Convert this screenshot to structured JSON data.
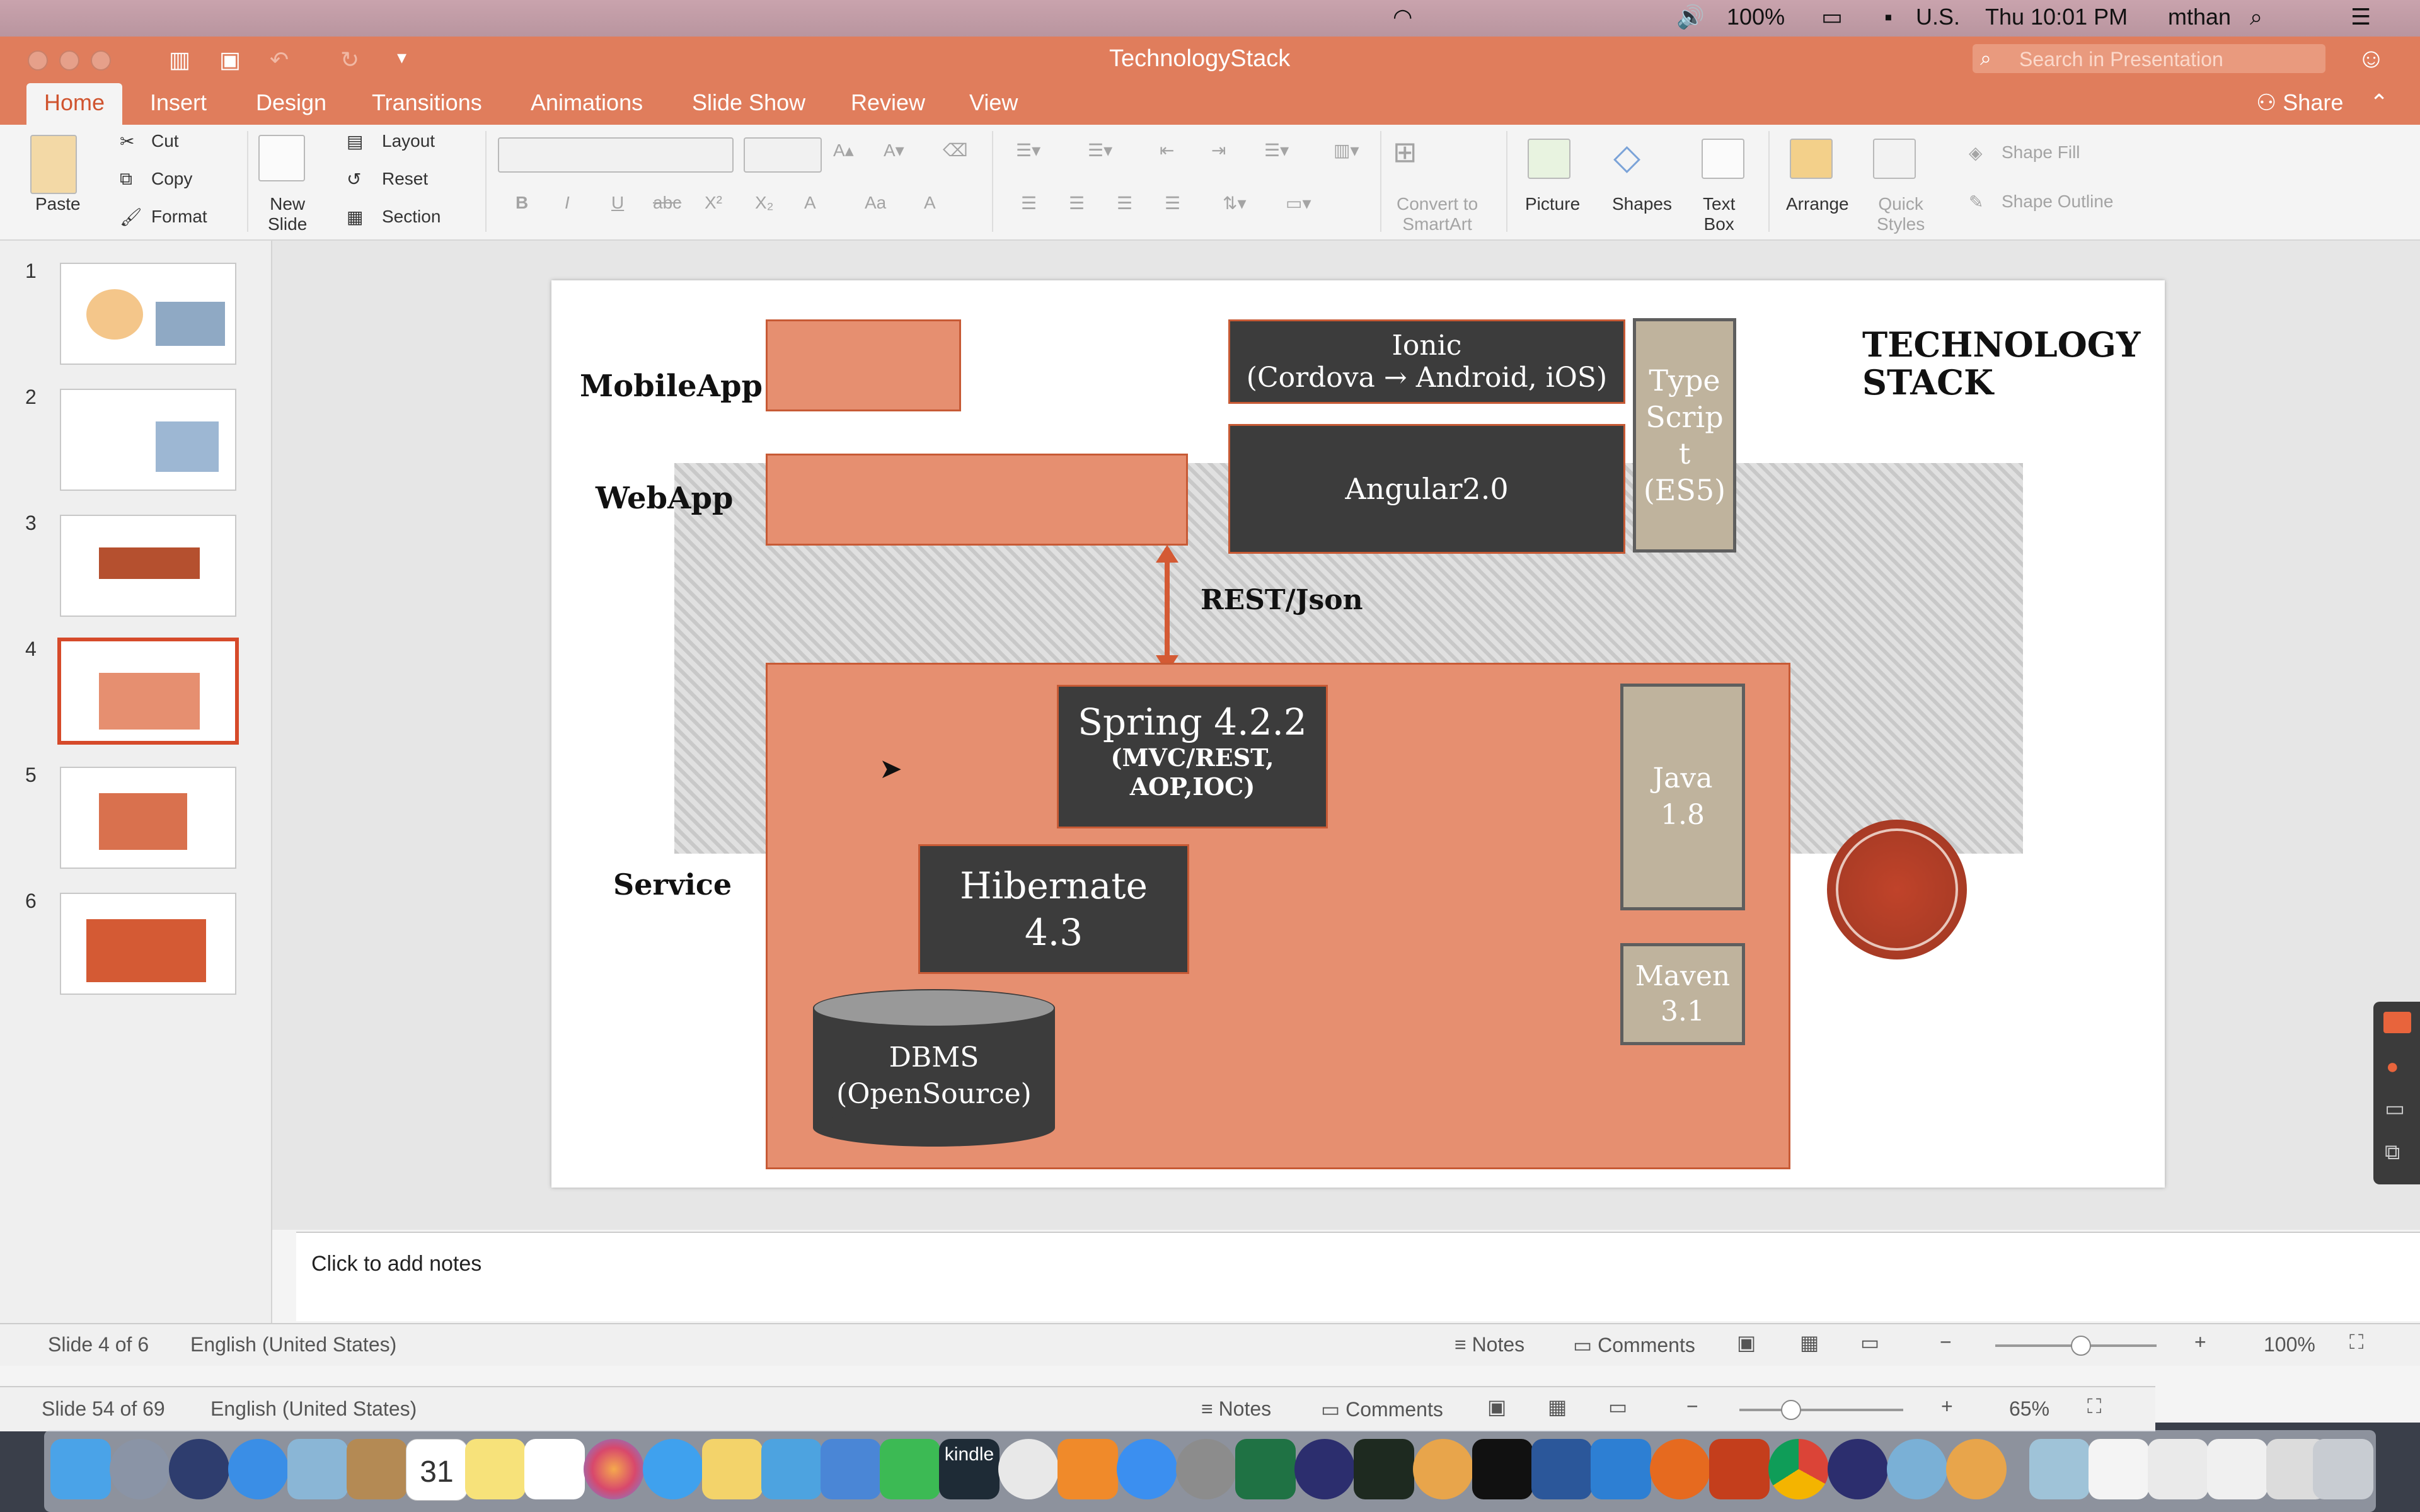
{
  "menubar": {
    "battery": "100%",
    "input_source": "U.S.",
    "clock": "Thu 10:01 PM",
    "user": "mthan"
  },
  "window": {
    "title": "TechnologyStack",
    "search_placeholder": "Search in Presentation",
    "share_label": "Share"
  },
  "tabs": [
    "Home",
    "Insert",
    "Design",
    "Transitions",
    "Animations",
    "Slide Show",
    "Review",
    "View"
  ],
  "ribbon": {
    "paste": "Paste",
    "cut": "Cut",
    "copy": "Copy",
    "format": "Format",
    "new_slide": "New\nSlide",
    "layout": "Layout",
    "reset": "Reset",
    "section": "Section",
    "convert": "Convert to\nSmartArt",
    "picture": "Picture",
    "shapes": "Shapes",
    "textbox": "Text\nBox",
    "arrange": "Arrange",
    "quick_styles": "Quick\nStyles",
    "shape_fill": "Shape Fill",
    "shape_outline": "Shape Outline"
  },
  "thumbnails": [
    "1",
    "2",
    "3",
    "4",
    "5",
    "6"
  ],
  "slide": {
    "title": "TECHNOLOGY\nSTACK",
    "label_mobile": "MobileApp",
    "label_web": "WebApp",
    "label_service": "Service",
    "ionic": "Ionic\n(Cordova → Android, iOS)",
    "angular": "Angular2.0",
    "typescript": "Type\nScrip\nt\n(ES5)",
    "rest": "REST/Json",
    "spring": "Spring 4.2.2",
    "spring_sub": "(MVC/REST,\nAOP,IOC)",
    "hibernate": "Hibernate\n4.3",
    "java": "Java\n1.8",
    "maven": "Maven\n3.1",
    "dbms": "DBMS\n(OpenSource)"
  },
  "notes_placeholder": "Click to add notes",
  "status": {
    "slide": "Slide 4 of 6",
    "lang": "English (United States)",
    "notes": "Notes",
    "comments": "Comments",
    "zoom": "100%"
  },
  "status_behind": {
    "slide": "Slide 54 of 69",
    "lang": "English (United States)",
    "notes": "Notes",
    "comments": "Comments",
    "zoom": "65%"
  },
  "colors": {
    "accent": "#e07d5c",
    "slide_orange": "#e68f70",
    "dark_box": "#3c3c3c",
    "tan_box": "#bfb39d"
  }
}
